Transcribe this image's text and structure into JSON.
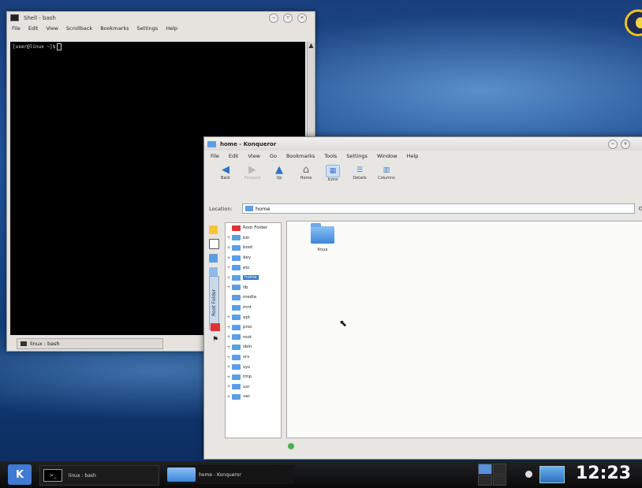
{
  "konsole": {
    "title": "Shell - bash",
    "menu": [
      "File",
      "Edit",
      "View",
      "Scrollback",
      "Bookmarks",
      "Settings",
      "Help"
    ],
    "prompt": "[user@linux ~]$",
    "tab_label": "linux : bash"
  },
  "konqueror": {
    "title": "home - Konqueror",
    "menu": [
      "File",
      "Edit",
      "View",
      "Go",
      "Bookmarks",
      "Tools",
      "Settings",
      "Window",
      "Help"
    ],
    "toolbar": {
      "back": "Back",
      "forward": "Forward",
      "up": "Up",
      "home": "Home",
      "icons": "Icons",
      "details": "Details",
      "columns": "Columns"
    },
    "location_label": "Location:",
    "location_value": "home",
    "sidebar_tab": "Root Folder",
    "tree_root": "Root Folder",
    "tree_items": [
      "bin",
      "boot",
      "dev",
      "etc",
      "home",
      "lib",
      "media",
      "mnt",
      "opt",
      "proc",
      "root",
      "sbin",
      "srv",
      "sys",
      "tmp",
      "usr",
      "var"
    ],
    "selected_item": "home",
    "folder_item": "linux"
  },
  "taskbar": {
    "tasks": [
      "linux : bash",
      "home - Konqueror"
    ],
    "clock": "12:23"
  }
}
